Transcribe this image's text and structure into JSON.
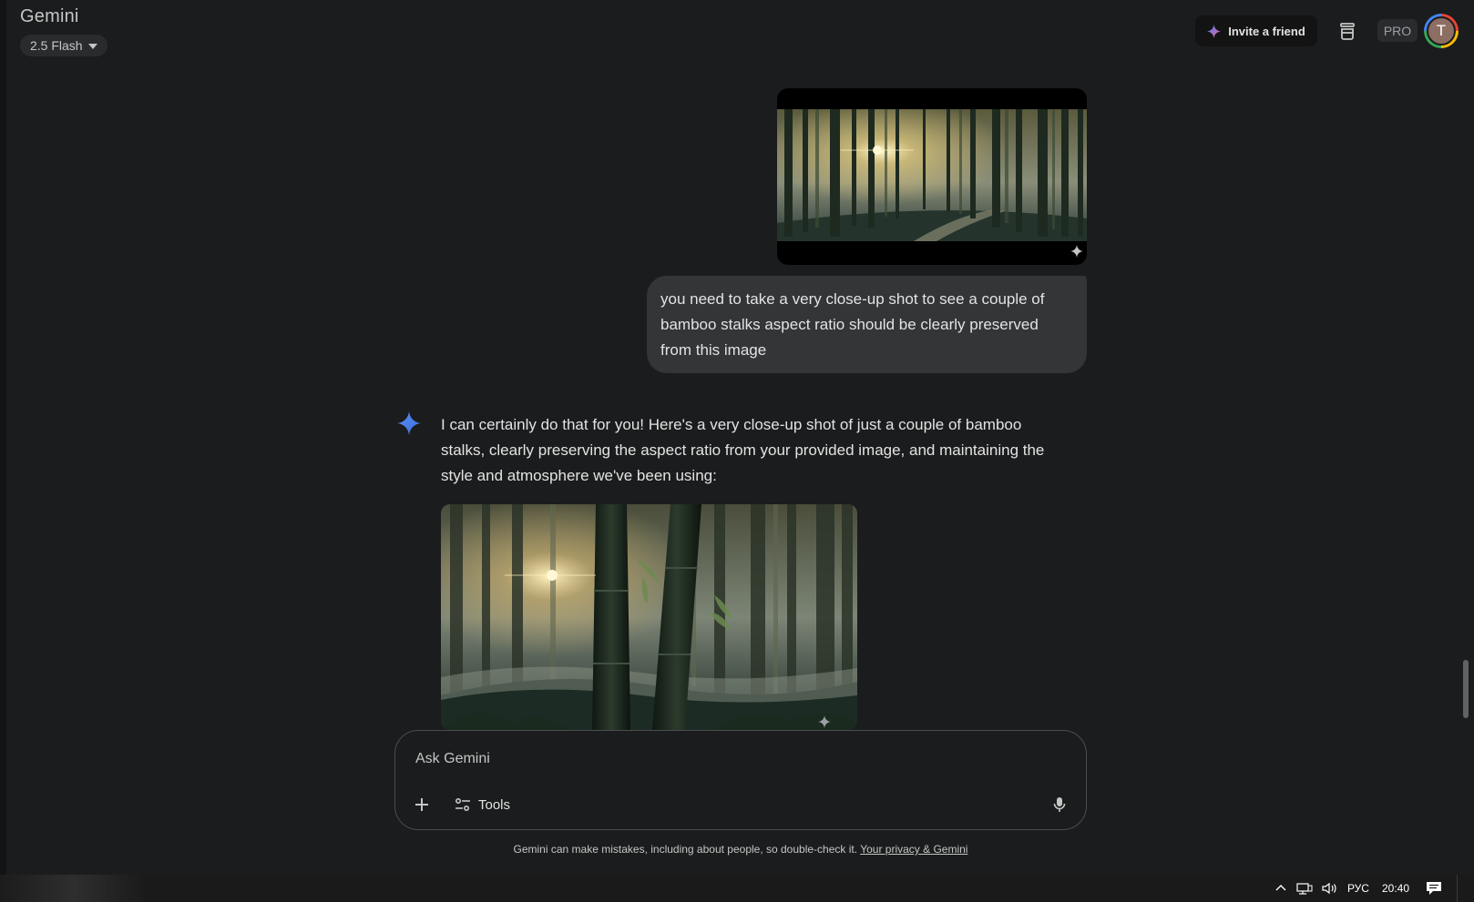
{
  "app": {
    "title": "Gemini",
    "model": "2.5 Flash"
  },
  "header": {
    "invite_label": "Invite a friend",
    "pro_label": "PRO",
    "avatar_initial": "T"
  },
  "conversation": {
    "user_message": "you need to take a very close-up shot to see a couple of bamboo stalks aspect ratio should be clearly preserved from this image",
    "response_text": "I can certainly do that for you! Here's a very close-up shot of just a couple of bamboo stalks, clearly preserving the aspect ratio from your provided image, and maintaining the style and atmosphere we've been using:"
  },
  "input": {
    "placeholder": "Ask Gemini",
    "tools_label": "Tools"
  },
  "footer": {
    "disclaimer": "Gemini can make mistakes, including about people, so double-check it.",
    "privacy_link": "Your privacy & Gemini"
  },
  "taskbar": {
    "language": "РУС",
    "time": "20:40"
  },
  "colors": {
    "background": "#1b1c1d",
    "bubble": "#333537",
    "accent_blue": "#4285f4"
  }
}
